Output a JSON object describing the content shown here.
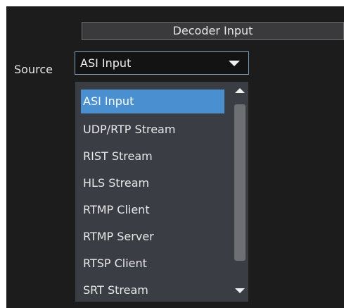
{
  "section": {
    "title": "Decoder Input"
  },
  "source": {
    "label": "Source",
    "selected_value": "ASI Input",
    "options": [
      "ASI Input",
      "UDP/RTP Stream",
      "RIST Stream",
      "HLS Stream",
      "RTMP Client",
      "RTMP Server",
      "RTSP Client",
      "SRT Stream"
    ],
    "selected_index": 0
  },
  "colors": {
    "background": "#1c1c1c",
    "header_bg": "#3a3a3c",
    "dropdown_bg": "#3a3d44",
    "selected_option": "#4a90d0",
    "select_border": "#7fa4c4",
    "scroll_thumb": "#6e6f73"
  },
  "icons": {
    "select_caret": "chevron-down-icon",
    "scroll_up": "arrow-up-icon",
    "scroll_down": "arrow-down-icon"
  }
}
